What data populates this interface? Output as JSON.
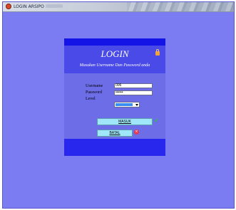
{
  "window": {
    "title": "LOGIN ARSIPO"
  },
  "login": {
    "title": "LOGIN",
    "subtitle": "Masukan Username Dan Password anda",
    "username_label": "Username",
    "password_label": "Password",
    "level_label": "Level",
    "username_value": "006",
    "password_value": "••••••",
    "submit_label": "MASUK",
    "cancel_label": "BATAL"
  },
  "colors": {
    "background": "#7b7bf2",
    "panel": "#2727ee",
    "form_area": "#6d6de8",
    "button": "#9fe6f8"
  },
  "icons": [
    "app-icon",
    "lock-icon",
    "chevron-down-icon",
    "check-icon",
    "cancel-icon"
  ]
}
